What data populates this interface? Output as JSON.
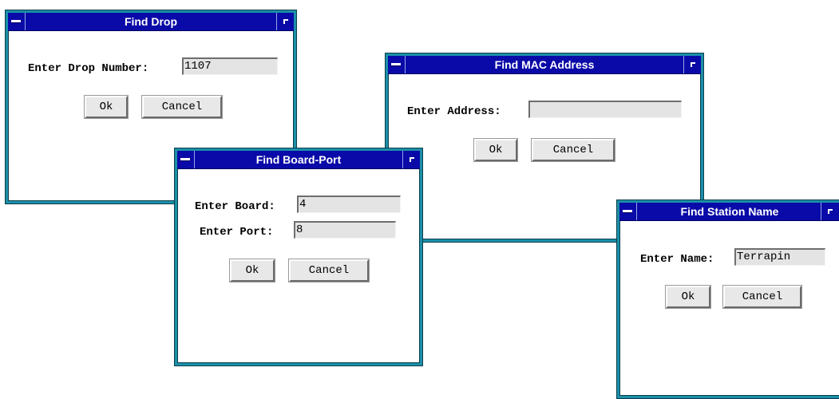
{
  "dialogs": {
    "find_drop": {
      "title": "Find Drop",
      "label": "Enter Drop Number:",
      "value": "1107",
      "ok": "Ok",
      "cancel": "Cancel"
    },
    "find_mac": {
      "title": "Find MAC Address",
      "label": "Enter Address:",
      "value": "",
      "ok": "Ok",
      "cancel": "Cancel"
    },
    "find_board_port": {
      "title": "Find Board-Port",
      "board_label": "Enter Board:",
      "board_value": "4",
      "port_label": "Enter Port:",
      "port_value": "8",
      "ok": "Ok",
      "cancel": "Cancel"
    },
    "find_station": {
      "title": "Find Station Name",
      "label": "Enter Name:",
      "value": "Terrapin",
      "ok": "Ok",
      "cancel": "Cancel"
    }
  },
  "colors": {
    "titlebar": "#0a0aa8",
    "frame": "#1c8fa8",
    "field": "#e4e4e4",
    "button": "#e8e8e8"
  },
  "icons": [
    "window-menu-icon",
    "window-maximize-icon"
  ]
}
